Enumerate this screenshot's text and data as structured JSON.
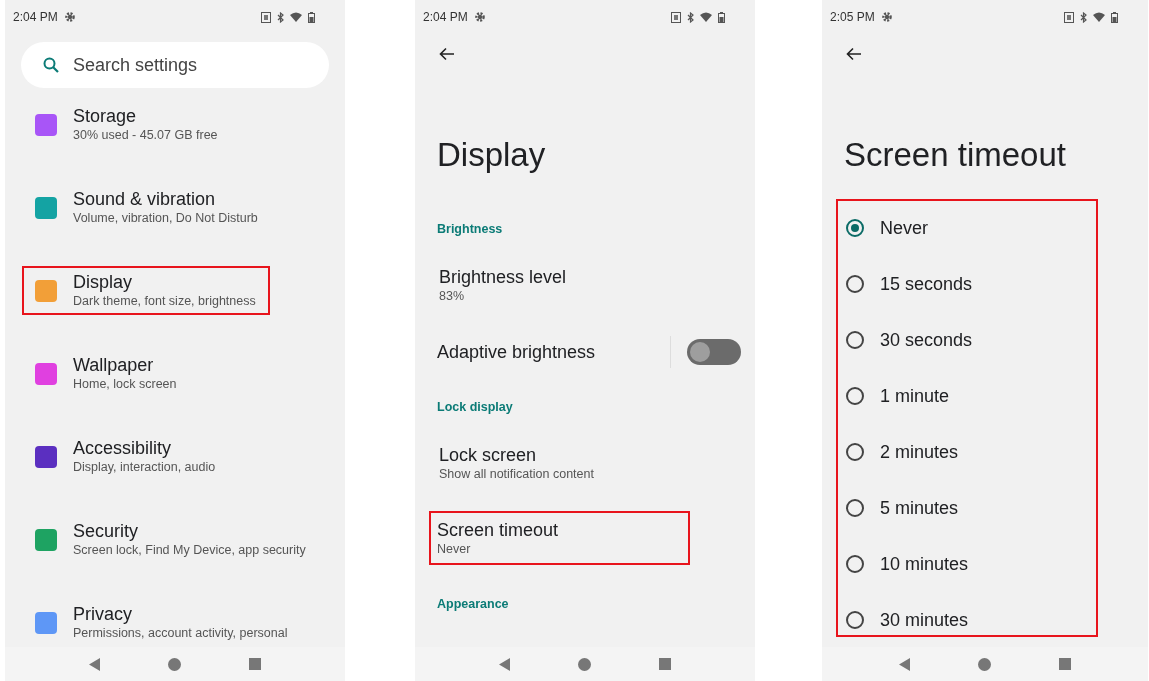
{
  "screens": [
    {
      "kind": "settings_list",
      "time": "2:04 PM",
      "search": {
        "placeholder": "Search settings"
      },
      "items": [
        {
          "title": "Storage",
          "subtitle": "30% used - 45.07 GB free",
          "color": "#a855f7",
          "highlighted": false
        },
        {
          "title": "Sound & vibration",
          "subtitle": "Volume, vibration, Do Not Disturb",
          "color": "#14a3a3",
          "highlighted": false
        },
        {
          "title": "Display",
          "subtitle": "Dark theme, font size, brightness",
          "color": "#f29f38",
          "highlighted": true
        },
        {
          "title": "Wallpaper",
          "subtitle": "Home, lock screen",
          "color": "#e040e0",
          "highlighted": false
        },
        {
          "title": "Accessibility",
          "subtitle": "Display, interaction, audio",
          "color": "#5b2fc0",
          "highlighted": false
        },
        {
          "title": "Security",
          "subtitle": "Screen lock, Find My Device, app security",
          "color": "#1ea362",
          "highlighted": false
        },
        {
          "title": "Privacy",
          "subtitle": "Permissions, account activity, personal",
          "color": "#5e97f6",
          "highlighted": false
        }
      ]
    },
    {
      "kind": "detail",
      "time": "2:04 PM",
      "title": "Display",
      "rows": [
        {
          "kind": "section",
          "title": "Brightness"
        },
        {
          "kind": "item",
          "title": "Brightness level",
          "subtitle": "83%",
          "highlighted": false
        },
        {
          "kind": "switch",
          "title": "Adaptive brightness",
          "on": false
        },
        {
          "kind": "section",
          "title": "Lock display"
        },
        {
          "kind": "item",
          "title": "Lock screen",
          "subtitle": "Show all notification content",
          "highlighted": false
        },
        {
          "kind": "item",
          "title": "Screen timeout",
          "subtitle": "Never",
          "highlighted": true
        },
        {
          "kind": "section",
          "title": "Appearance"
        }
      ]
    },
    {
      "kind": "radio_list",
      "time": "2:05 PM",
      "title": "Screen timeout",
      "highlighted": true,
      "options": [
        {
          "label": "Never",
          "selected": true
        },
        {
          "label": "15 seconds",
          "selected": false
        },
        {
          "label": "30 seconds",
          "selected": false
        },
        {
          "label": "1 minute",
          "selected": false
        },
        {
          "label": "2 minutes",
          "selected": false
        },
        {
          "label": "5 minutes",
          "selected": false
        },
        {
          "label": "10 minutes",
          "selected": false
        },
        {
          "label": "30 minutes",
          "selected": false
        }
      ]
    }
  ]
}
